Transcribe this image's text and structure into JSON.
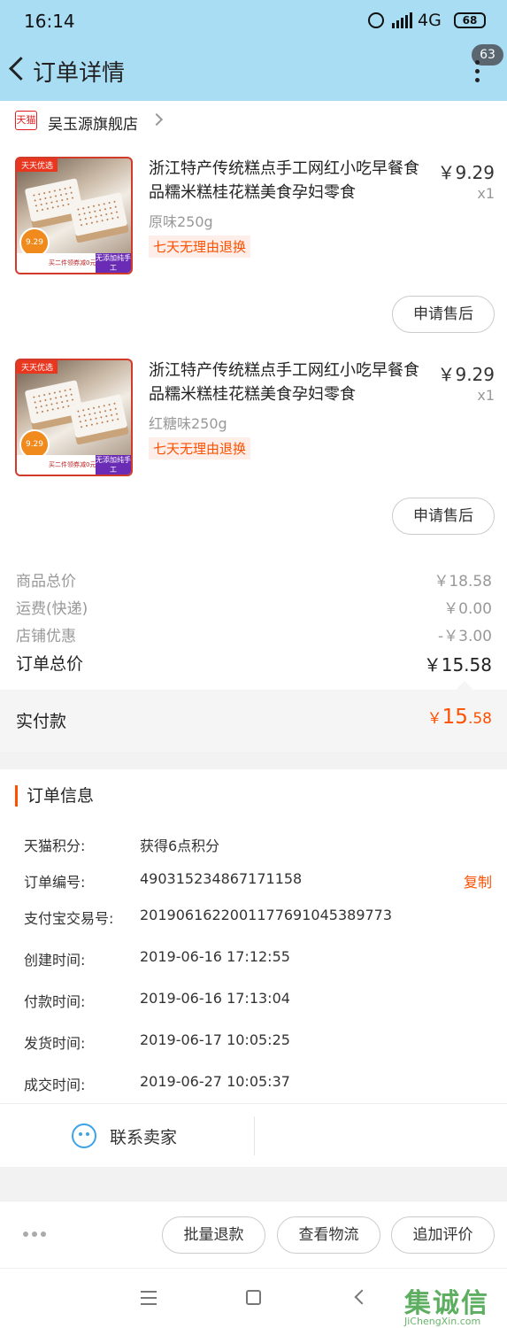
{
  "status_bar": {
    "time": "16:14",
    "network": "4G",
    "battery": "68"
  },
  "header": {
    "title": "订单详情",
    "badge_count": "63"
  },
  "shop": {
    "platform_icon": "天猫",
    "name": "吴玉源旗舰店"
  },
  "products": [
    {
      "title": "浙江特产传统糕点手工网红小吃早餐食品糯米糕桂花糕美食孕妇零食",
      "price": "￥9.29",
      "qty": "x1",
      "spec": "原味250g",
      "return_policy": "七天无理由退换",
      "after_sale_label": "申请售后",
      "thumb_tag": "天天优选",
      "thumb_price": "9.29",
      "thumb_note": "买二件领券减0元",
      "thumb_badge": "无添加纯手工"
    },
    {
      "title": "浙江特产传统糕点手工网红小吃早餐食品糯米糕桂花糕美食孕妇零食",
      "price": "￥9.29",
      "qty": "x1",
      "spec": "红糖味250g",
      "return_policy": "七天无理由退换",
      "after_sale_label": "申请售后",
      "thumb_tag": "天天优选",
      "thumb_price": "9.29",
      "thumb_note": "买二件领券减0元",
      "thumb_badge": "无添加纯手工"
    }
  ],
  "summary": {
    "goods_total_label": "商品总价",
    "goods_total": "￥18.58",
    "shipping_label": "运费(快递)",
    "shipping": "￥0.00",
    "discount_label": "店铺优惠",
    "discount": "-￥3.00",
    "order_total_label": "订单总价",
    "order_total": "￥15.58",
    "paid_label": "实付款",
    "paid_currency": "￥",
    "paid_int": "15",
    "paid_dec": ".58"
  },
  "order_info": {
    "title": "订单信息",
    "copy_label": "复制",
    "rows": [
      {
        "key": "天猫积分:",
        "value": "获得6点积分"
      },
      {
        "key": "订单编号:",
        "value": "490315234867171158"
      },
      {
        "key": "支付宝交易号:",
        "value": "2019061622001177691045389773"
      },
      {
        "key": "创建时间:",
        "value": "2019-06-16 17:12:55"
      },
      {
        "key": "付款时间:",
        "value": "2019-06-16 17:13:04"
      },
      {
        "key": "发货时间:",
        "value": "2019-06-17 10:05:25"
      },
      {
        "key": "成交时间:",
        "value": "2019-06-27 10:05:37"
      }
    ]
  },
  "contact": {
    "label": "联系卖家"
  },
  "actions": {
    "batch_refund": "批量退款",
    "view_logistics": "查看物流",
    "add_review": "追加评价"
  },
  "watermark": {
    "text": "集诚信",
    "sub": "JiChengXin.com"
  },
  "colors": {
    "accent": "#ff5000",
    "header_bg": "#a9ddf4",
    "tmall_red": "#e02020",
    "contact_blue": "#3ea2e8"
  }
}
